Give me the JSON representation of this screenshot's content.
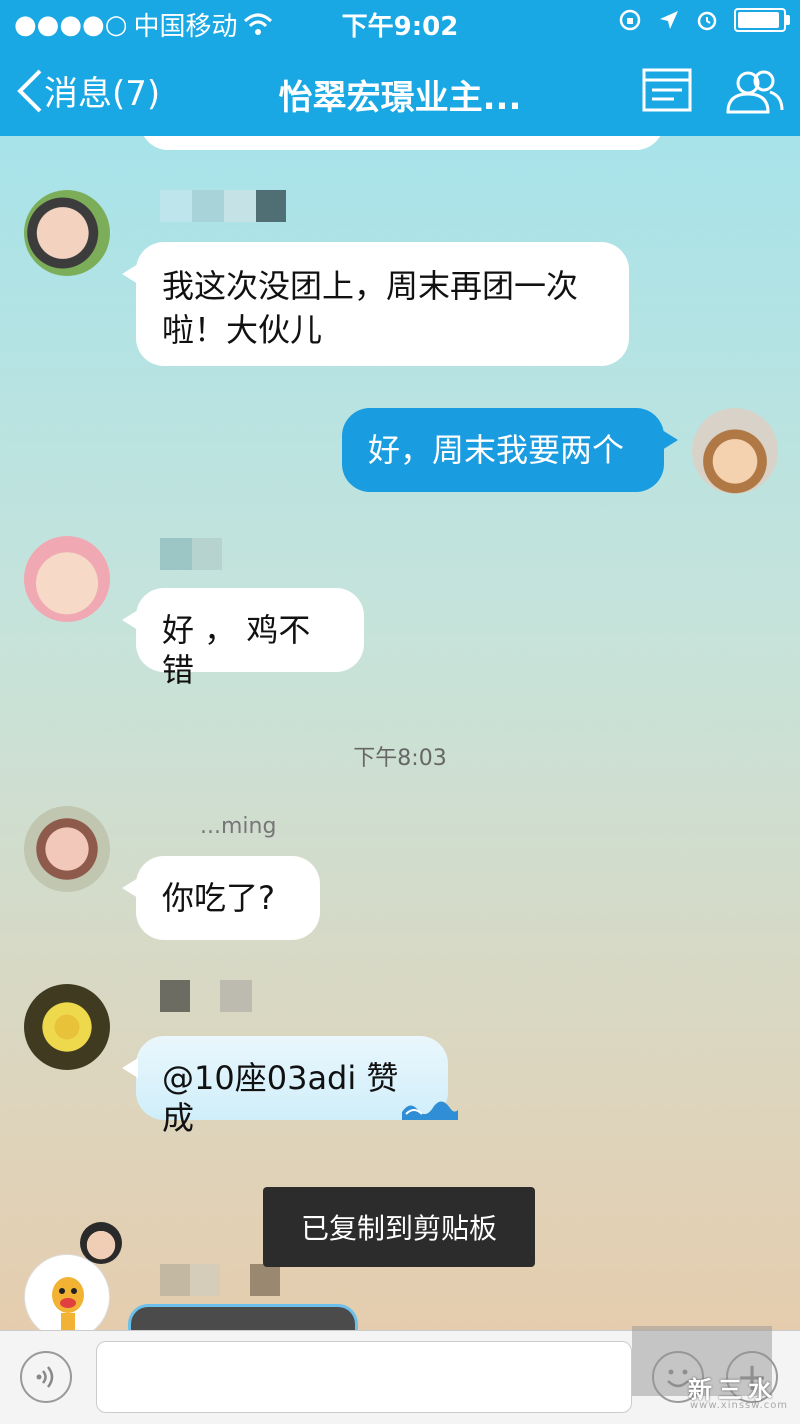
{
  "status_bar": {
    "carrier": "中国移动",
    "time": "下午9:02",
    "battery_level": 0.85
  },
  "nav": {
    "back_label": "消息(7)",
    "title": "怡翠宏璟业主..."
  },
  "messages": [
    {
      "side": "left",
      "text": "我这次没团上，周末再团一次啦！大伙儿"
    },
    {
      "side": "right",
      "text": "好，周末我要两个"
    },
    {
      "side": "left",
      "text": "好 ， 鸡不错"
    },
    {
      "side": "timestamp",
      "text": "下午8:03"
    },
    {
      "side": "left",
      "nick_fragment": "...ming",
      "text": "你吃了?"
    },
    {
      "side": "left",
      "text": "@10座03adi 赞成"
    }
  ],
  "toast": {
    "text": "已复制到剪贴板"
  },
  "input": {
    "value": "",
    "placeholder": ""
  },
  "watermark": {
    "text": "新三水",
    "sub": "www.xinssw.com"
  },
  "colors": {
    "accent": "#1aa8e4",
    "right_bubble": "#1a9ce0"
  }
}
